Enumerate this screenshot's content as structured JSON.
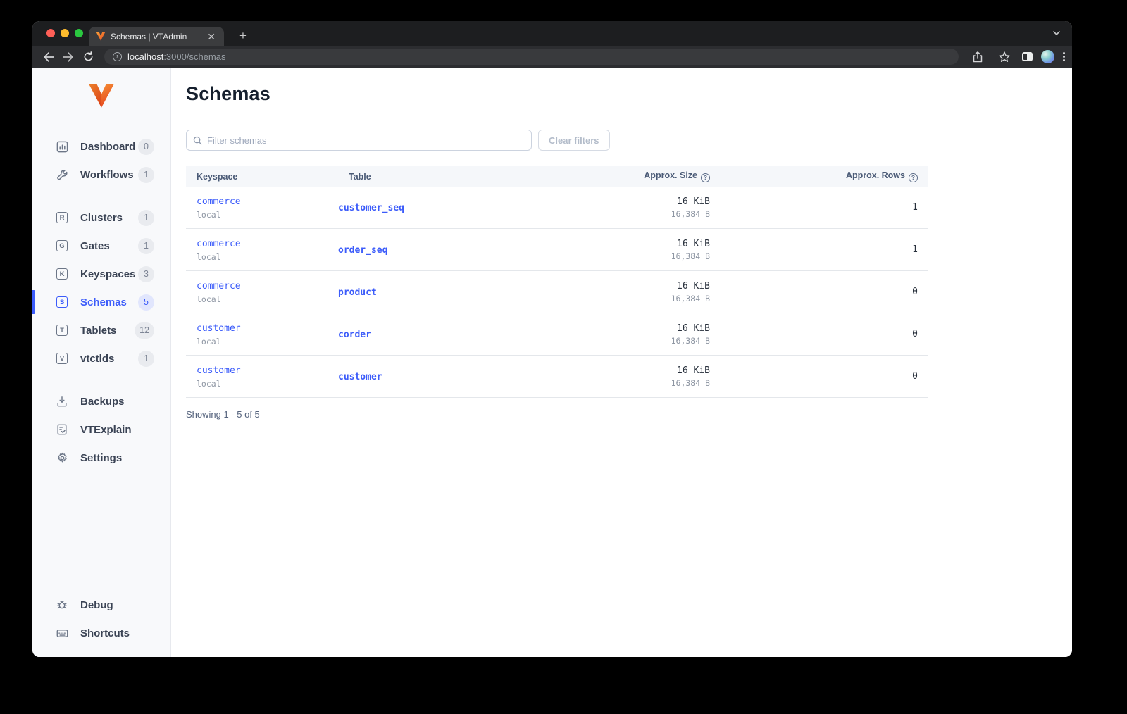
{
  "browser": {
    "tab_title": "Schemas | VTAdmin",
    "url_host": "localhost",
    "url_rest": ":3000/schemas"
  },
  "sidebar": {
    "items": [
      {
        "label": "Dashboard",
        "badge": "0"
      },
      {
        "label": "Workflows",
        "badge": "1"
      },
      {
        "label": "Clusters",
        "badge": "1",
        "letter": "R"
      },
      {
        "label": "Gates",
        "badge": "1",
        "letter": "G"
      },
      {
        "label": "Keyspaces",
        "badge": "3",
        "letter": "K"
      },
      {
        "label": "Schemas",
        "badge": "5",
        "letter": "S",
        "active": true
      },
      {
        "label": "Tablets",
        "badge": "12",
        "letter": "T"
      },
      {
        "label": "vtctlds",
        "badge": "1",
        "letter": "V"
      },
      {
        "label": "Backups"
      },
      {
        "label": "VTExplain"
      },
      {
        "label": "Settings"
      },
      {
        "label": "Debug"
      },
      {
        "label": "Shortcuts"
      }
    ]
  },
  "main": {
    "title": "Schemas",
    "filter_placeholder": "Filter schemas",
    "clear_filters_label": "Clear filters",
    "table": {
      "headers": {
        "keyspace": "Keyspace",
        "table": "Table",
        "size": "Approx. Size",
        "rows": "Approx. Rows"
      },
      "rows": [
        {
          "keyspace": "commerce",
          "cluster": "local",
          "table": "customer_seq",
          "size": "16 KiB",
          "size_bytes": "16,384 B",
          "approx_rows": "1"
        },
        {
          "keyspace": "commerce",
          "cluster": "local",
          "table": "order_seq",
          "size": "16 KiB",
          "size_bytes": "16,384 B",
          "approx_rows": "1"
        },
        {
          "keyspace": "commerce",
          "cluster": "local",
          "table": "product",
          "size": "16 KiB",
          "size_bytes": "16,384 B",
          "approx_rows": "0"
        },
        {
          "keyspace": "customer",
          "cluster": "local",
          "table": "corder",
          "size": "16 KiB",
          "size_bytes": "16,384 B",
          "approx_rows": "0"
        },
        {
          "keyspace": "customer",
          "cluster": "local",
          "table": "customer",
          "size": "16 KiB",
          "size_bytes": "16,384 B",
          "approx_rows": "0"
        }
      ]
    },
    "footer": "Showing 1 - 5 of 5"
  },
  "colors": {
    "accent": "#3c5cfa",
    "link": "#3c5cfa",
    "sidebar_bg": "#f8f9fb",
    "table_header_bg": "#f5f7fa",
    "logo_gradient_top": "#f9a13a",
    "logo_gradient_bottom": "#e6491f"
  }
}
